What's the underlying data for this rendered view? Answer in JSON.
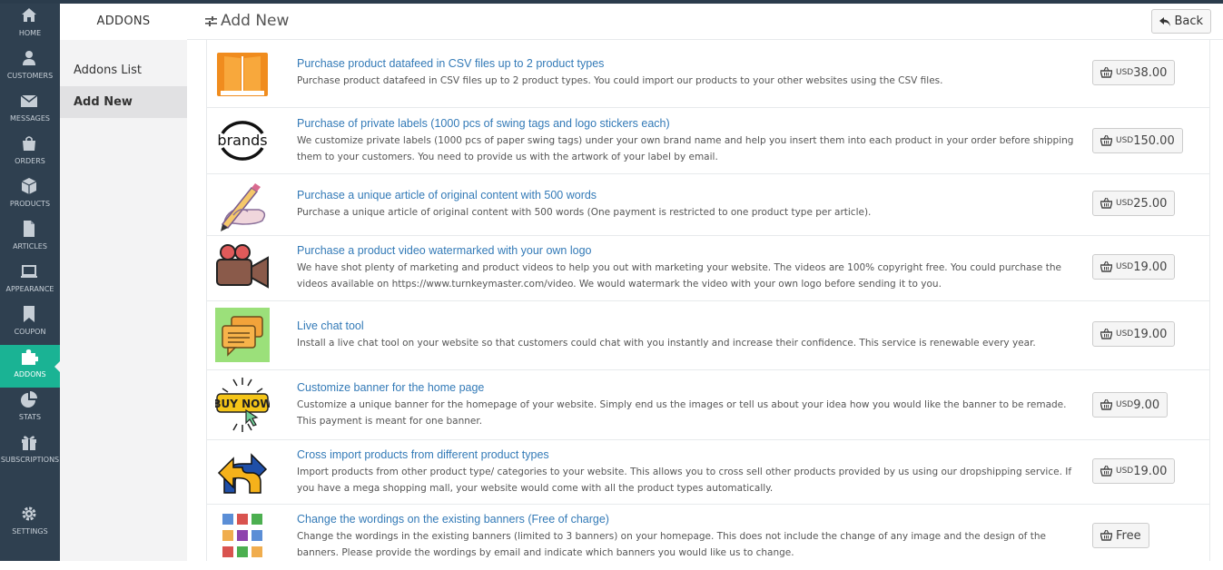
{
  "nav": {
    "items": [
      {
        "label": "HOME",
        "icon": "home-icon"
      },
      {
        "label": "CUSTOMERS",
        "icon": "user-icon"
      },
      {
        "label": "MESSAGES",
        "icon": "envelope-icon"
      },
      {
        "label": "ORDERS",
        "icon": "shopping-bag-icon"
      },
      {
        "label": "PRODUCTS",
        "icon": "cube-icon"
      },
      {
        "label": "ARTICLES",
        "icon": "file-icon"
      },
      {
        "label": "APPEARANCE",
        "icon": "laptop-icon"
      },
      {
        "label": "COUPON",
        "icon": "bookmark-icon"
      },
      {
        "label": "ADDONS",
        "icon": "puzzle-icon"
      },
      {
        "label": "STATS",
        "icon": "pie-chart-icon"
      },
      {
        "label": "SUBSCRIPTIONS",
        "icon": "gift-icon"
      },
      {
        "label": "SETTINGS",
        "icon": "gear-icon"
      }
    ],
    "active": "ADDONS"
  },
  "subnav": {
    "title": "ADDONS",
    "items": [
      {
        "label": "Addons List"
      },
      {
        "label": "Add New"
      }
    ],
    "active": "Add New"
  },
  "header": {
    "title": "Add New",
    "back_label": "Back"
  },
  "addons": [
    {
      "title": "Purchase product datafeed in CSV files up to 2 product types",
      "description": "Purchase product datafeed in CSV files up to 2 product types. You could import our products to your other websites using the CSV files.",
      "currency": "USD",
      "price": "38.00",
      "icon": "book-icon"
    },
    {
      "title": "Purchase of private labels (1000 pcs of swing tags and logo stickers each)",
      "description": "We customize private labels (1000 pcs of paper swing tags) under your own brand name and help you insert them into each product in your order before shipping them to your customers. You need to provide us with the artwork of your label by email.",
      "currency": "USD",
      "price": "150.00",
      "icon": "brands-logo-icon",
      "icon_text": "brands"
    },
    {
      "title": "Purchase a unique article of original content with 500 words",
      "description": "Purchase a unique article of original content with 500 words (One payment is restricted to one product type per article).",
      "currency": "USD",
      "price": "25.00",
      "icon": "writing-hand-icon"
    },
    {
      "title": "Purchase a product video watermarked with your own logo",
      "description": "We have shot plenty of marketing and product videos to help you out with marketing your website. The videos are 100% copyright free. You could purchase the videos available on https://www.turnkeymaster.com/video. We would watermark the video with your own logo before sending it to you.",
      "currency": "USD",
      "price": "19.00",
      "icon": "video-camera-icon"
    },
    {
      "title": "Live chat tool",
      "description": "Install a live chat tool on your website so that customers could chat with you instantly and increase their confidence. This service is renewable every year.",
      "currency": "USD",
      "price": "19.00",
      "icon": "chat-bubble-icon"
    },
    {
      "title": "Customize banner for the home page",
      "description": "Customize a unique banner for the homepage of your website. Simply end us the images or tell us about your idea how you would like the banner to be remade. This payment is meant for one banner.",
      "currency": "USD",
      "price": "9.00",
      "icon": "buy-now-icon",
      "icon_text": "BUY NOW"
    },
    {
      "title": "Cross import products from different product types",
      "description": "Import products from other product type/ categories to your website. This allows you to cross sell other products provided by us using our dropshipping service. If you have a mega shopping mall, your website would come with all the product types automatically.",
      "currency": "USD",
      "price": "19.00",
      "icon": "cross-arrows-icon"
    },
    {
      "title": "Change the wordings on the existing banners (Free of charge)",
      "description": "Change the wordings in the existing banners (limited to 3 banners) on your homepage. This does not include the change of any image and the design of the banners. Please provide the wordings by email and indicate which banners you would like us to change.",
      "currency": "",
      "price": "Free",
      "icon": "banner-grid-icon"
    }
  ]
}
